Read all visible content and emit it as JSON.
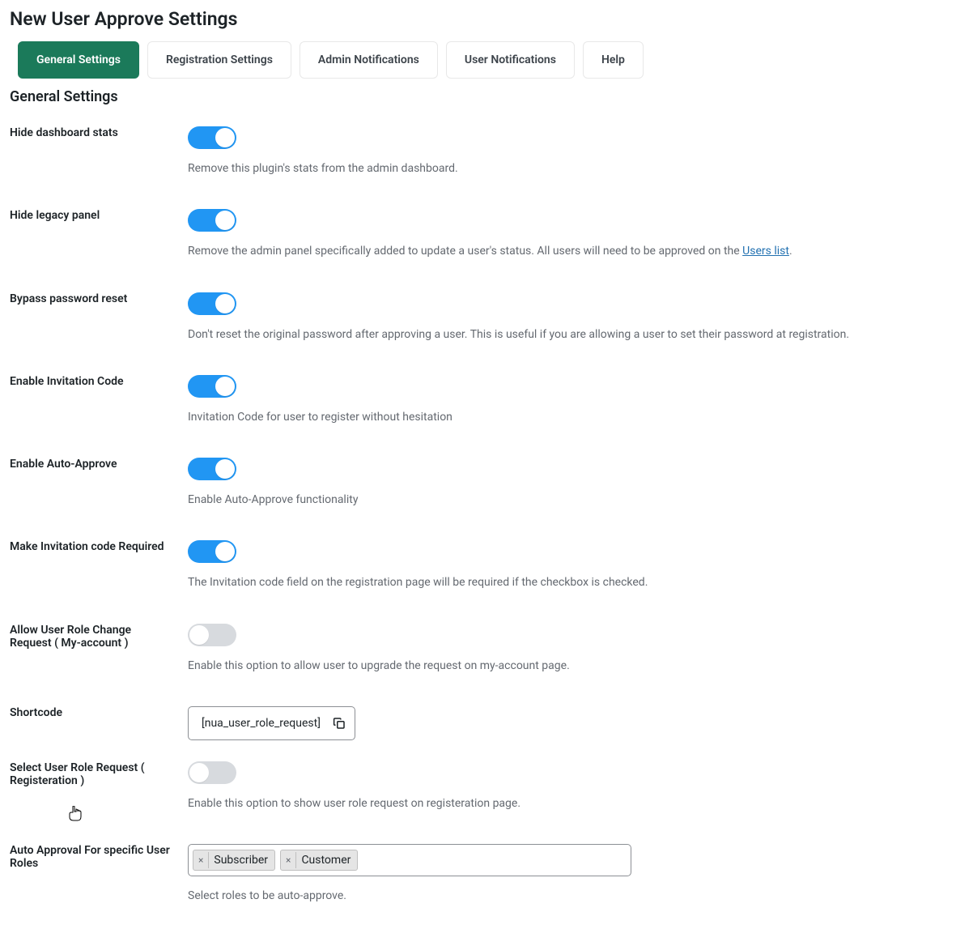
{
  "page_title": "New User Approve Settings",
  "tabs": [
    {
      "label": "General Settings",
      "active": true
    },
    {
      "label": "Registration Settings",
      "active": false
    },
    {
      "label": "Admin Notifications",
      "active": false
    },
    {
      "label": "User Notifications",
      "active": false
    },
    {
      "label": "Help",
      "active": false
    }
  ],
  "section_title": "General Settings",
  "settings": {
    "hide_dashboard_stats": {
      "label": "Hide dashboard stats",
      "on": true,
      "desc": "Remove this plugin's stats from the admin dashboard."
    },
    "hide_legacy_panel": {
      "label": "Hide legacy panel",
      "on": true,
      "desc_prefix": "Remove the admin panel specifically added to update a user's status. All users will need to be approved on the ",
      "desc_link_text": "Users list",
      "desc_suffix": "."
    },
    "bypass_password_reset": {
      "label": "Bypass password reset",
      "on": true,
      "desc": "Don't reset the original password after approving a user. This is useful if you are allowing a user to set their password at registration."
    },
    "enable_invitation_code": {
      "label": "Enable Invitation Code",
      "on": true,
      "desc": "Invitation Code for user to register without hesitation"
    },
    "enable_auto_approve": {
      "label": "Enable Auto-Approve",
      "on": true,
      "desc": "Enable Auto-Approve functionality"
    },
    "make_invitation_required": {
      "label": "Make Invitation code Required",
      "on": true,
      "desc": "The Invitation code field on the registration page will be required if the checkbox is checked."
    },
    "allow_user_role_change": {
      "label": "Allow User Role Change Request ( My-account )",
      "on": false,
      "desc": "Enable this option to allow user to upgrade the request on my-account page."
    },
    "shortcode": {
      "label": "Shortcode",
      "value": "[nua_user_role_request]"
    },
    "select_user_role_request": {
      "label": "Select User Role Request ( Registeration )",
      "on": false,
      "desc": "Enable this option to show user role request on registeration page."
    },
    "auto_approval_roles": {
      "label": "Auto Approval For specific User Roles",
      "tags": [
        "Subscriber",
        "Customer"
      ],
      "desc": "Select roles to be auto-approve."
    }
  }
}
